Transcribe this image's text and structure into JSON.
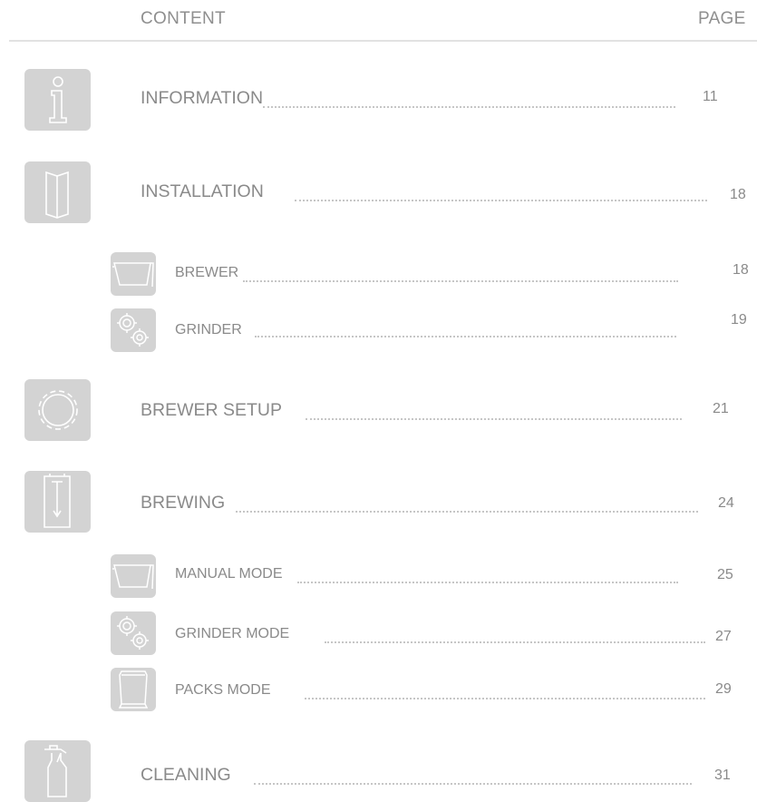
{
  "header": {
    "content_label": "CONTENT",
    "page_label": "PAGE"
  },
  "entries": [
    {
      "title": "INFORMATION",
      "page": "11",
      "icon": "info-icon"
    },
    {
      "title": "INSTALLATION",
      "page": "18",
      "icon": "folded-document-icon"
    },
    {
      "title": "BREWER",
      "page": "18",
      "icon": "brew-basket-icon"
    },
    {
      "title": "GRINDER",
      "page": "19",
      "icon": "gears-icon"
    },
    {
      "title": "BREWER SETUP",
      "page": "21",
      "icon": "gear-icon"
    },
    {
      "title": "BREWING",
      "page": "24",
      "icon": "brewer-machine-icon"
    },
    {
      "title": "MANUAL MODE",
      "page": "25",
      "icon": "brew-basket-icon"
    },
    {
      "title": "GRINDER MODE",
      "page": "27",
      "icon": "gears-icon"
    },
    {
      "title": "PACKS MODE",
      "page": "29",
      "icon": "coffee-pack-icon"
    },
    {
      "title": "CLEANING",
      "page": "31",
      "icon": "spray-bottle-icon"
    }
  ],
  "colors": {
    "icon_bg": "#d3d3d3",
    "icon_fg": "#ffffff",
    "text": "#8a8a8a",
    "dots": "#c6c6c6"
  }
}
